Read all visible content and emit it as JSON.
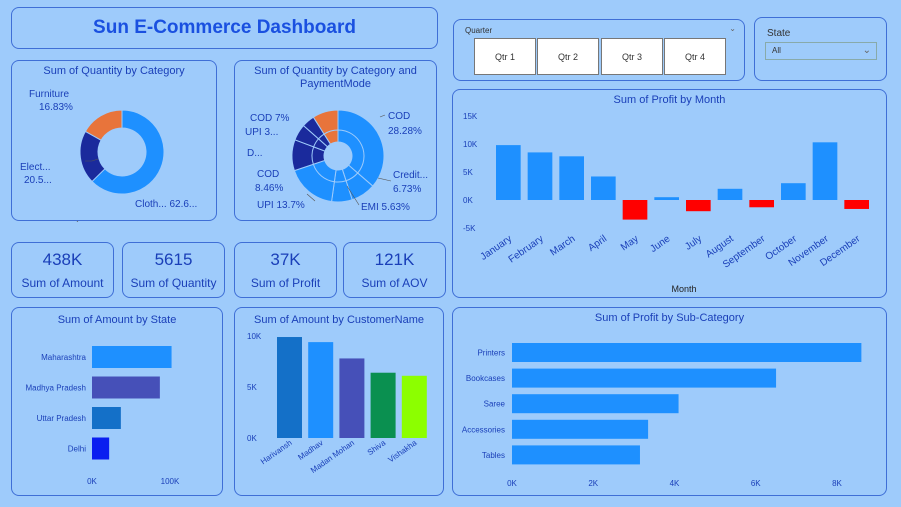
{
  "title": "Sun E-Commerce Dashboard",
  "quarter_slicer": {
    "label": "Quarter",
    "options": [
      "Qtr 1",
      "Qtr 2",
      "Qtr 3",
      "Qtr 4"
    ]
  },
  "state_slicer": {
    "label": "State",
    "value": "All"
  },
  "kpis": [
    {
      "value": "438K",
      "label": "Sum of Amount"
    },
    {
      "value": "5615",
      "label": "Sum of Quantity"
    },
    {
      "value": "37K",
      "label": "Sum of Profit"
    },
    {
      "value": "121K",
      "label": "Sum of AOV"
    }
  ],
  "colors": {
    "bg": "#9ecbfb",
    "accent": "#1a50e0",
    "blue": "#1e90ff",
    "navy": "#1a2a9c",
    "orange": "#e8743b",
    "red": "#ff0000"
  },
  "chart_data": [
    {
      "type": "pie",
      "title": "Sum of Quantity by Category",
      "labels": [
        "Furniture",
        "Electronics",
        "Clothing"
      ],
      "label_texts": [
        [
          "Furniture",
          "16.83%"
        ],
        [
          "Elect...",
          "20.5..."
        ],
        [
          "Cloth... 62.6..."
        ]
      ],
      "values": [
        16.83,
        20.53,
        62.64
      ],
      "colors": [
        "#e8743b",
        "#1a2a9c",
        "#1e90ff"
      ]
    },
    {
      "type": "pie",
      "title": "Sum of Quantity by Category and PaymentMode",
      "labels": [
        "COD",
        "Credit Card",
        "EMI",
        "UPI",
        "COD",
        "Debit Card",
        "UPI",
        "COD"
      ],
      "label_texts": [
        "COD 7%",
        "UPI 3...",
        "D...",
        "COD",
        "8.46%",
        "UPI 13.7%",
        "EMI 5.63%",
        "Credit...",
        "6.73%",
        "COD",
        "28.28%"
      ],
      "values": [
        28.28,
        6.73,
        5.63,
        13.7,
        8.46,
        4.5,
        3.5,
        7
      ],
      "colors": [
        "#1e90ff",
        "#1e90ff",
        "#1e90ff",
        "#1e90ff",
        "#1a2a9c",
        "#1a2a9c",
        "#1a2a9c",
        "#e8743b"
      ]
    },
    {
      "type": "bar",
      "title": "Sum of Profit by Month",
      "xlabel": "Month",
      "categories": [
        "January",
        "February",
        "March",
        "April",
        "May",
        "June",
        "July",
        "August",
        "September",
        "October",
        "November",
        "December"
      ],
      "values": [
        9800,
        8500,
        7800,
        4200,
        -3500,
        500,
        -2000,
        2000,
        -1300,
        3000,
        10300,
        -1600
      ],
      "yticks": [
        "15K",
        "10K",
        "5K",
        "0K",
        "-5K"
      ],
      "ylim": [
        -5000,
        15000
      ]
    },
    {
      "type": "bar",
      "title": "Sum of Amount by State",
      "categories": [
        "Maharashtra",
        "Madhya Pradesh",
        "Uttar Pradesh",
        "Delhi"
      ],
      "values": [
        102000,
        87000,
        37000,
        22000
      ],
      "colors": [
        "#1e90ff",
        "#4650b8",
        "#1470c8",
        "#0a1ef0"
      ],
      "xticks": [
        "0K",
        "100K"
      ],
      "xlim": [
        0,
        100000
      ]
    },
    {
      "type": "bar",
      "title": "Sum of Amount by CustomerName",
      "categories": [
        "Harivansh",
        "Madhav",
        "Madan Mohan",
        "Shiva",
        "Vishakha"
      ],
      "values": [
        9900,
        9400,
        7800,
        6400,
        6100
      ],
      "colors": [
        "#1470c8",
        "#1e90ff",
        "#4650b8",
        "#0a9050",
        "#8cff00"
      ],
      "yticks": [
        "10K",
        "5K",
        "0K"
      ],
      "ylim": [
        0,
        10000
      ]
    },
    {
      "type": "bar",
      "title": "Sum of Profit by Sub-Category",
      "categories": [
        "Printers",
        "Bookcases",
        "Saree",
        "Accessories",
        "Tables"
      ],
      "values": [
        8600,
        6500,
        4100,
        3350,
        3150
      ],
      "xticks": [
        "0K",
        "2K",
        "4K",
        "6K",
        "8K"
      ],
      "xlim": [
        0,
        8000
      ]
    }
  ]
}
